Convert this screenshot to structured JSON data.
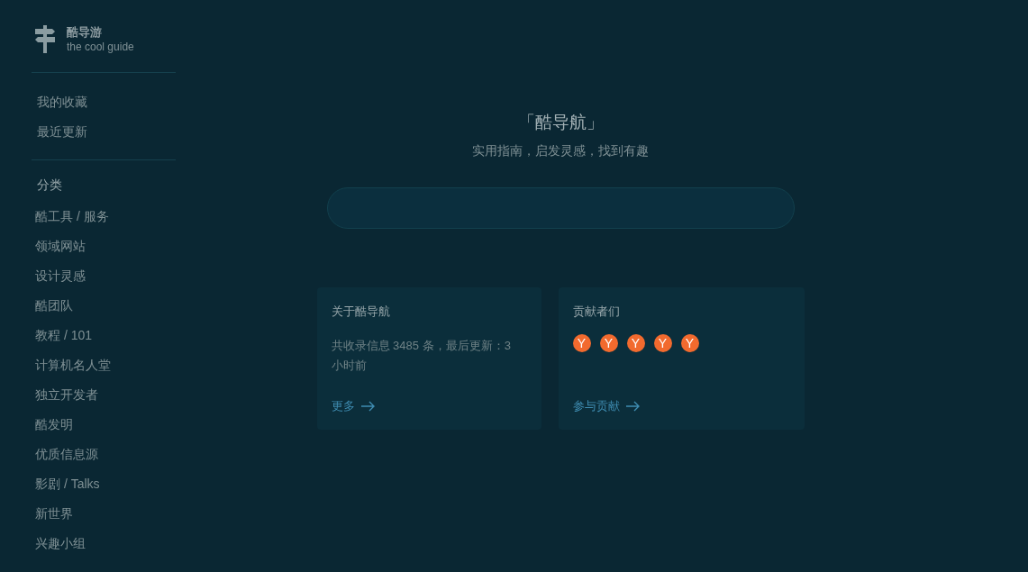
{
  "brand": {
    "title": "酷导游",
    "subtitle": "the cool guide"
  },
  "sidebar": {
    "links": [
      {
        "label": "我的收藏"
      },
      {
        "label": "最近更新"
      }
    ],
    "category_heading": "分类",
    "categories": [
      {
        "label": "酷工具 / 服务"
      },
      {
        "label": "领域网站"
      },
      {
        "label": "设计灵感"
      },
      {
        "label": "酷团队"
      },
      {
        "label": "教程 / 101"
      },
      {
        "label": "计算机名人堂"
      },
      {
        "label": "独立开发者"
      },
      {
        "label": "酷发明"
      },
      {
        "label": "优质信息源"
      },
      {
        "label": "影剧 / Talks"
      },
      {
        "label": "新世界"
      },
      {
        "label": "兴趣小组"
      }
    ]
  },
  "hero": {
    "title": "「酷导航」",
    "subtitle": "实用指南，启发灵感，找到有趣"
  },
  "cards": [
    {
      "kind": "about",
      "title": "关于酷导航",
      "text": "共收录信息 3485 条，最后更新：3 小时前",
      "link": "更多"
    },
    {
      "kind": "contributors",
      "title": "贡献者们",
      "avatars": [
        "Y",
        "Y",
        "Y",
        "Y",
        "Y"
      ],
      "link": "参与贡献"
    }
  ]
}
